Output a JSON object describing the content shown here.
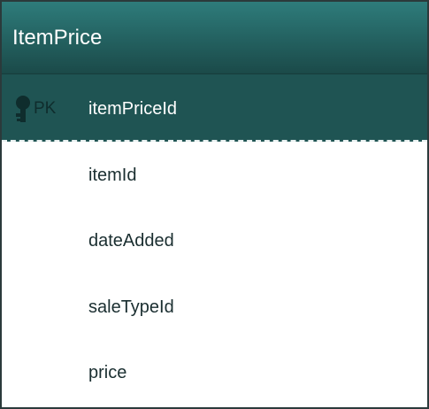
{
  "entity": {
    "name": "ItemPrice",
    "primary_key": {
      "badge": "PK",
      "field": "itemPriceId"
    },
    "fields": [
      "itemId",
      "dateAdded",
      "saleTypeId",
      "price"
    ]
  },
  "colors": {
    "header_top": "#2e7c7b",
    "header_bottom": "#1b4a49",
    "pk_row": "#1f5453",
    "border": "#2b3a3b",
    "field_text": "#1a2e30",
    "header_text": "#ffffff"
  },
  "icons": {
    "primary_key": "key-icon"
  }
}
